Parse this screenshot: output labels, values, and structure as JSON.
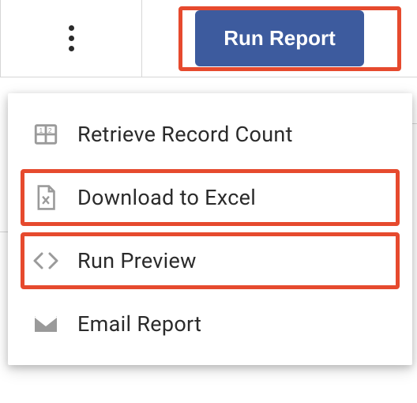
{
  "toolbar": {
    "run_report_label": "Run Report"
  },
  "menu": {
    "items": [
      {
        "label": "Retrieve Record Count",
        "icon": "record-count-icon",
        "highlighted": false
      },
      {
        "label": "Download to Excel",
        "icon": "excel-file-icon",
        "highlighted": true
      },
      {
        "label": "Run Preview",
        "icon": "code-brackets-icon",
        "highlighted": true
      },
      {
        "label": "Email Report",
        "icon": "email-icon",
        "highlighted": false
      }
    ]
  },
  "colors": {
    "primary_button": "#3d5b9e",
    "highlight_border": "#e64a2e",
    "icon": "#9a9a9a",
    "text": "#2b2b2b"
  }
}
